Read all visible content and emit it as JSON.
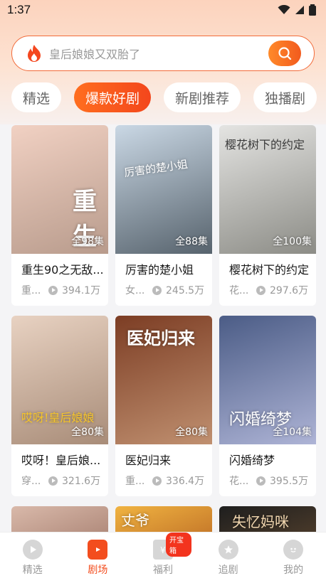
{
  "status_bar": {
    "time": "1:37"
  },
  "search": {
    "placeholder": "皇后娘娘又双胎了"
  },
  "tabs": [
    {
      "label": "精选"
    },
    {
      "label": "爆款好剧"
    },
    {
      "label": "新剧推荐"
    },
    {
      "label": "独播剧"
    }
  ],
  "cards": [
    {
      "title": "重生90之无敌...",
      "tag": "重...",
      "views": "394.1万",
      "episodes": "全98集",
      "poster_text": "重生",
      "colors": [
        "#f1d1c3",
        "#b89b8c"
      ]
    },
    {
      "title": "厉害的楚小姐",
      "tag": "女...",
      "views": "245.5万",
      "episodes": "全88集",
      "poster_text": "厉害的楚小姐",
      "colors": [
        "#cad8e5",
        "#57636d"
      ]
    },
    {
      "title": "樱花树下的约定",
      "tag": "花...",
      "views": "297.6万",
      "episodes": "全100集",
      "poster_text": "樱花树下的约定",
      "colors": [
        "#e4e4e2",
        "#8c8c86"
      ]
    },
    {
      "title": "哎呀！皇后娘...",
      "tag": "穿...",
      "views": "321.6万",
      "episodes": "全80集",
      "poster_text": "哎呀!皇后娘娘",
      "colors": [
        "#e8d2c2",
        "#a88c78"
      ]
    },
    {
      "title": "医妃归来",
      "tag": "重...",
      "views": "336.4万",
      "episodes": "全80集",
      "poster_text": "医妃归来",
      "colors": [
        "#7c3d24",
        "#c09070"
      ]
    },
    {
      "title": "闪婚绮梦",
      "tag": "花...",
      "views": "395.5万",
      "episodes": "全104集",
      "poster_text": "闪婚绮梦",
      "colors": [
        "#4b5c86",
        "#aeb4d6"
      ]
    }
  ],
  "bottom_nav": [
    {
      "label": "精选",
      "icon": "play-icon"
    },
    {
      "label": "剧场",
      "icon": "tv-icon",
      "active": true
    },
    {
      "label": "福利",
      "icon": "gift-icon",
      "badge": "开宝箱"
    },
    {
      "label": "追剧",
      "icon": "star-icon"
    },
    {
      "label": "我的",
      "icon": "face-icon"
    }
  ],
  "partial_posters": [
    {
      "colors": [
        "#d9b9aa",
        "#b08a7b"
      ]
    },
    {
      "colors": [
        "#f0b341",
        "#c6792a"
      ],
      "text": "丈爷"
    },
    {
      "colors": [
        "#1e1e1e",
        "#4a3a2a"
      ],
      "text": "失忆妈咪"
    }
  ],
  "colors": {
    "accent": "#f34d1e",
    "search_border": "#f26b3a"
  }
}
